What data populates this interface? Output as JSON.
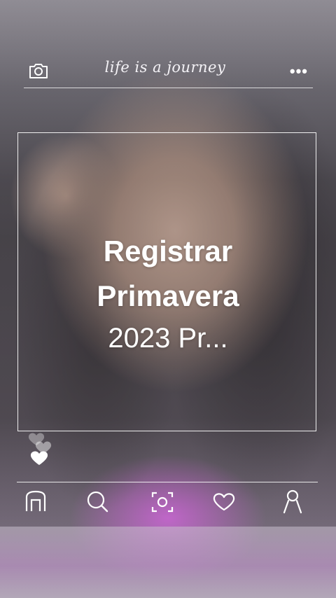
{
  "header": {
    "title": "life is a journey",
    "left_icon": "camera-icon",
    "right_icon": "more-icon",
    "more_glyph": "•••"
  },
  "caption": {
    "line1": "Registrar",
    "line2": "Primavera",
    "line3": "2023 Pr..."
  },
  "reactions": {
    "icon": "heart-icon"
  },
  "nav": {
    "items": [
      {
        "icon": "home-icon"
      },
      {
        "icon": "search-icon"
      },
      {
        "icon": "capture-icon"
      },
      {
        "icon": "heart-icon"
      },
      {
        "icon": "profile-icon"
      }
    ]
  },
  "colors": {
    "overlay": "#ffffff",
    "accent": "#b64ac0"
  }
}
